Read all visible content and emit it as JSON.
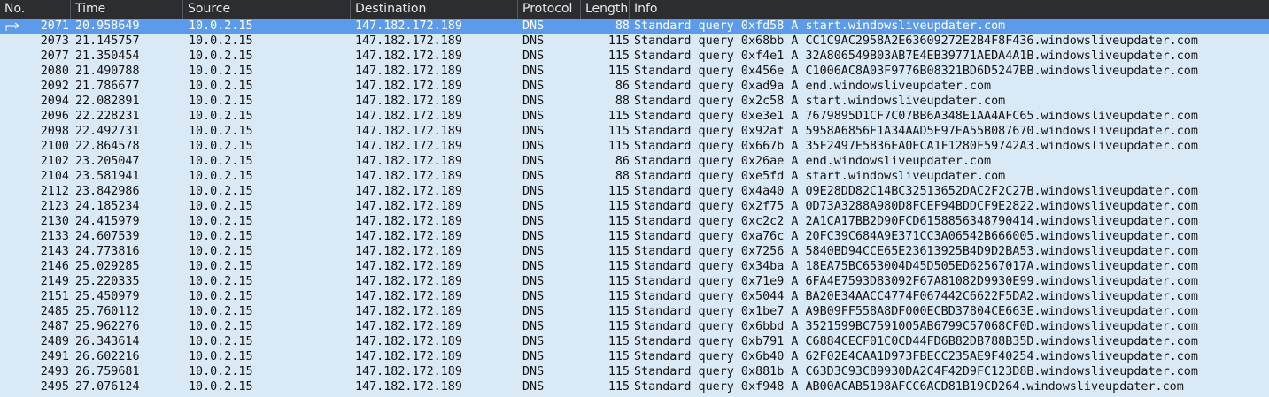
{
  "columns": {
    "no": "No.",
    "time": "Time",
    "source": "Source",
    "destination": "Destination",
    "protocol": "Protocol",
    "length": "Length",
    "info": "Info"
  },
  "selected_index": 0,
  "packets": [
    {
      "no": "2071",
      "time": "20.958649",
      "src": "10.0.2.15",
      "dst": "147.182.172.189",
      "proto": "DNS",
      "len": "88",
      "info": "Standard query 0xfd58 A start.windowsliveupdater.com"
    },
    {
      "no": "2073",
      "time": "21.145757",
      "src": "10.0.2.15",
      "dst": "147.182.172.189",
      "proto": "DNS",
      "len": "115",
      "info": "Standard query 0x68bb A CC1C9AC2958A2E63609272E2B4F8F436.windowsliveupdater.com"
    },
    {
      "no": "2077",
      "time": "21.350454",
      "src": "10.0.2.15",
      "dst": "147.182.172.189",
      "proto": "DNS",
      "len": "115",
      "info": "Standard query 0xf4e1 A 32A806549B03AB7E4EB39771AEDA4A1B.windowsliveupdater.com"
    },
    {
      "no": "2080",
      "time": "21.490788",
      "src": "10.0.2.15",
      "dst": "147.182.172.189",
      "proto": "DNS",
      "len": "115",
      "info": "Standard query 0x456e A C1006AC8A03F9776B08321BD6D5247BB.windowsliveupdater.com"
    },
    {
      "no": "2092",
      "time": "21.786677",
      "src": "10.0.2.15",
      "dst": "147.182.172.189",
      "proto": "DNS",
      "len": "86",
      "info": "Standard query 0xad9a A end.windowsliveupdater.com"
    },
    {
      "no": "2094",
      "time": "22.082891",
      "src": "10.0.2.15",
      "dst": "147.182.172.189",
      "proto": "DNS",
      "len": "88",
      "info": "Standard query 0x2c58 A start.windowsliveupdater.com"
    },
    {
      "no": "2096",
      "time": "22.228231",
      "src": "10.0.2.15",
      "dst": "147.182.172.189",
      "proto": "DNS",
      "len": "115",
      "info": "Standard query 0xe3e1 A 7679895D1CF7C07BB6A348E1AA4AFC65.windowsliveupdater.com"
    },
    {
      "no": "2098",
      "time": "22.492731",
      "src": "10.0.2.15",
      "dst": "147.182.172.189",
      "proto": "DNS",
      "len": "115",
      "info": "Standard query 0x92af A 5958A6856F1A34AAD5E97EA55B087670.windowsliveupdater.com"
    },
    {
      "no": "2100",
      "time": "22.864578",
      "src": "10.0.2.15",
      "dst": "147.182.172.189",
      "proto": "DNS",
      "len": "115",
      "info": "Standard query 0x667b A 35F2497E5836EA0ECA1F1280F59742A3.windowsliveupdater.com"
    },
    {
      "no": "2102",
      "time": "23.205047",
      "src": "10.0.2.15",
      "dst": "147.182.172.189",
      "proto": "DNS",
      "len": "86",
      "info": "Standard query 0x26ae A end.windowsliveupdater.com"
    },
    {
      "no": "2104",
      "time": "23.581941",
      "src": "10.0.2.15",
      "dst": "147.182.172.189",
      "proto": "DNS",
      "len": "88",
      "info": "Standard query 0xe5fd A start.windowsliveupdater.com"
    },
    {
      "no": "2112",
      "time": "23.842986",
      "src": "10.0.2.15",
      "dst": "147.182.172.189",
      "proto": "DNS",
      "len": "115",
      "info": "Standard query 0x4a40 A 09E28DD82C14BC32513652DAC2F2C27B.windowsliveupdater.com"
    },
    {
      "no": "2123",
      "time": "24.185234",
      "src": "10.0.2.15",
      "dst": "147.182.172.189",
      "proto": "DNS",
      "len": "115",
      "info": "Standard query 0x2f75 A 0D73A3288A980D8FCEF94BDDCF9E2822.windowsliveupdater.com"
    },
    {
      "no": "2130",
      "time": "24.415979",
      "src": "10.0.2.15",
      "dst": "147.182.172.189",
      "proto": "DNS",
      "len": "115",
      "info": "Standard query 0xc2c2 A 2A1CA17BB2D90FCD6158856348790414.windowsliveupdater.com"
    },
    {
      "no": "2133",
      "time": "24.607539",
      "src": "10.0.2.15",
      "dst": "147.182.172.189",
      "proto": "DNS",
      "len": "115",
      "info": "Standard query 0xa76c A 20FC39C684A9E371CC3A06542B666005.windowsliveupdater.com"
    },
    {
      "no": "2143",
      "time": "24.773816",
      "src": "10.0.2.15",
      "dst": "147.182.172.189",
      "proto": "DNS",
      "len": "115",
      "info": "Standard query 0x7256 A 5840BD94CCE65E23613925B4D9D2BA53.windowsliveupdater.com"
    },
    {
      "no": "2146",
      "time": "25.029285",
      "src": "10.0.2.15",
      "dst": "147.182.172.189",
      "proto": "DNS",
      "len": "115",
      "info": "Standard query 0x34ba A 18EA75BC653004D45D505ED62567017A.windowsliveupdater.com"
    },
    {
      "no": "2149",
      "time": "25.220335",
      "src": "10.0.2.15",
      "dst": "147.182.172.189",
      "proto": "DNS",
      "len": "115",
      "info": "Standard query 0x71e9 A 6FA4E7593D83092F67A81082D9930E99.windowsliveupdater.com"
    },
    {
      "no": "2151",
      "time": "25.450979",
      "src": "10.0.2.15",
      "dst": "147.182.172.189",
      "proto": "DNS",
      "len": "115",
      "info": "Standard query 0x5044 A BA20E34AACC4774F067442C6622F5DA2.windowsliveupdater.com"
    },
    {
      "no": "2485",
      "time": "25.760112",
      "src": "10.0.2.15",
      "dst": "147.182.172.189",
      "proto": "DNS",
      "len": "115",
      "info": "Standard query 0x1be7 A A9B09FF558A8DF000ECBD37804CE663E.windowsliveupdater.com"
    },
    {
      "no": "2487",
      "time": "25.962276",
      "src": "10.0.2.15",
      "dst": "147.182.172.189",
      "proto": "DNS",
      "len": "115",
      "info": "Standard query 0x6bbd A 3521599BC7591005AB6799C57068CF0D.windowsliveupdater.com"
    },
    {
      "no": "2489",
      "time": "26.343614",
      "src": "10.0.2.15",
      "dst": "147.182.172.189",
      "proto": "DNS",
      "len": "115",
      "info": "Standard query 0xb791 A C6884CECF01C0CD44FD6B82DB788B35D.windowsliveupdater.com"
    },
    {
      "no": "2491",
      "time": "26.602216",
      "src": "10.0.2.15",
      "dst": "147.182.172.189",
      "proto": "DNS",
      "len": "115",
      "info": "Standard query 0x6b40 A 62F02E4CAA1D973FBECC235AE9F40254.windowsliveupdater.com"
    },
    {
      "no": "2493",
      "time": "26.759681",
      "src": "10.0.2.15",
      "dst": "147.182.172.189",
      "proto": "DNS",
      "len": "115",
      "info": "Standard query 0x881b A C63D3C93C89930DA2C4F42D9FC123D8B.windowsliveupdater.com"
    },
    {
      "no": "2495",
      "time": "27.076124",
      "src": "10.0.2.15",
      "dst": "147.182.172.189",
      "proto": "DNS",
      "len": "115",
      "info": "Standard query 0xf948 A AB00ACAB5198AFCC6ACD81B19CD264.windowsliveupdater.com"
    }
  ]
}
